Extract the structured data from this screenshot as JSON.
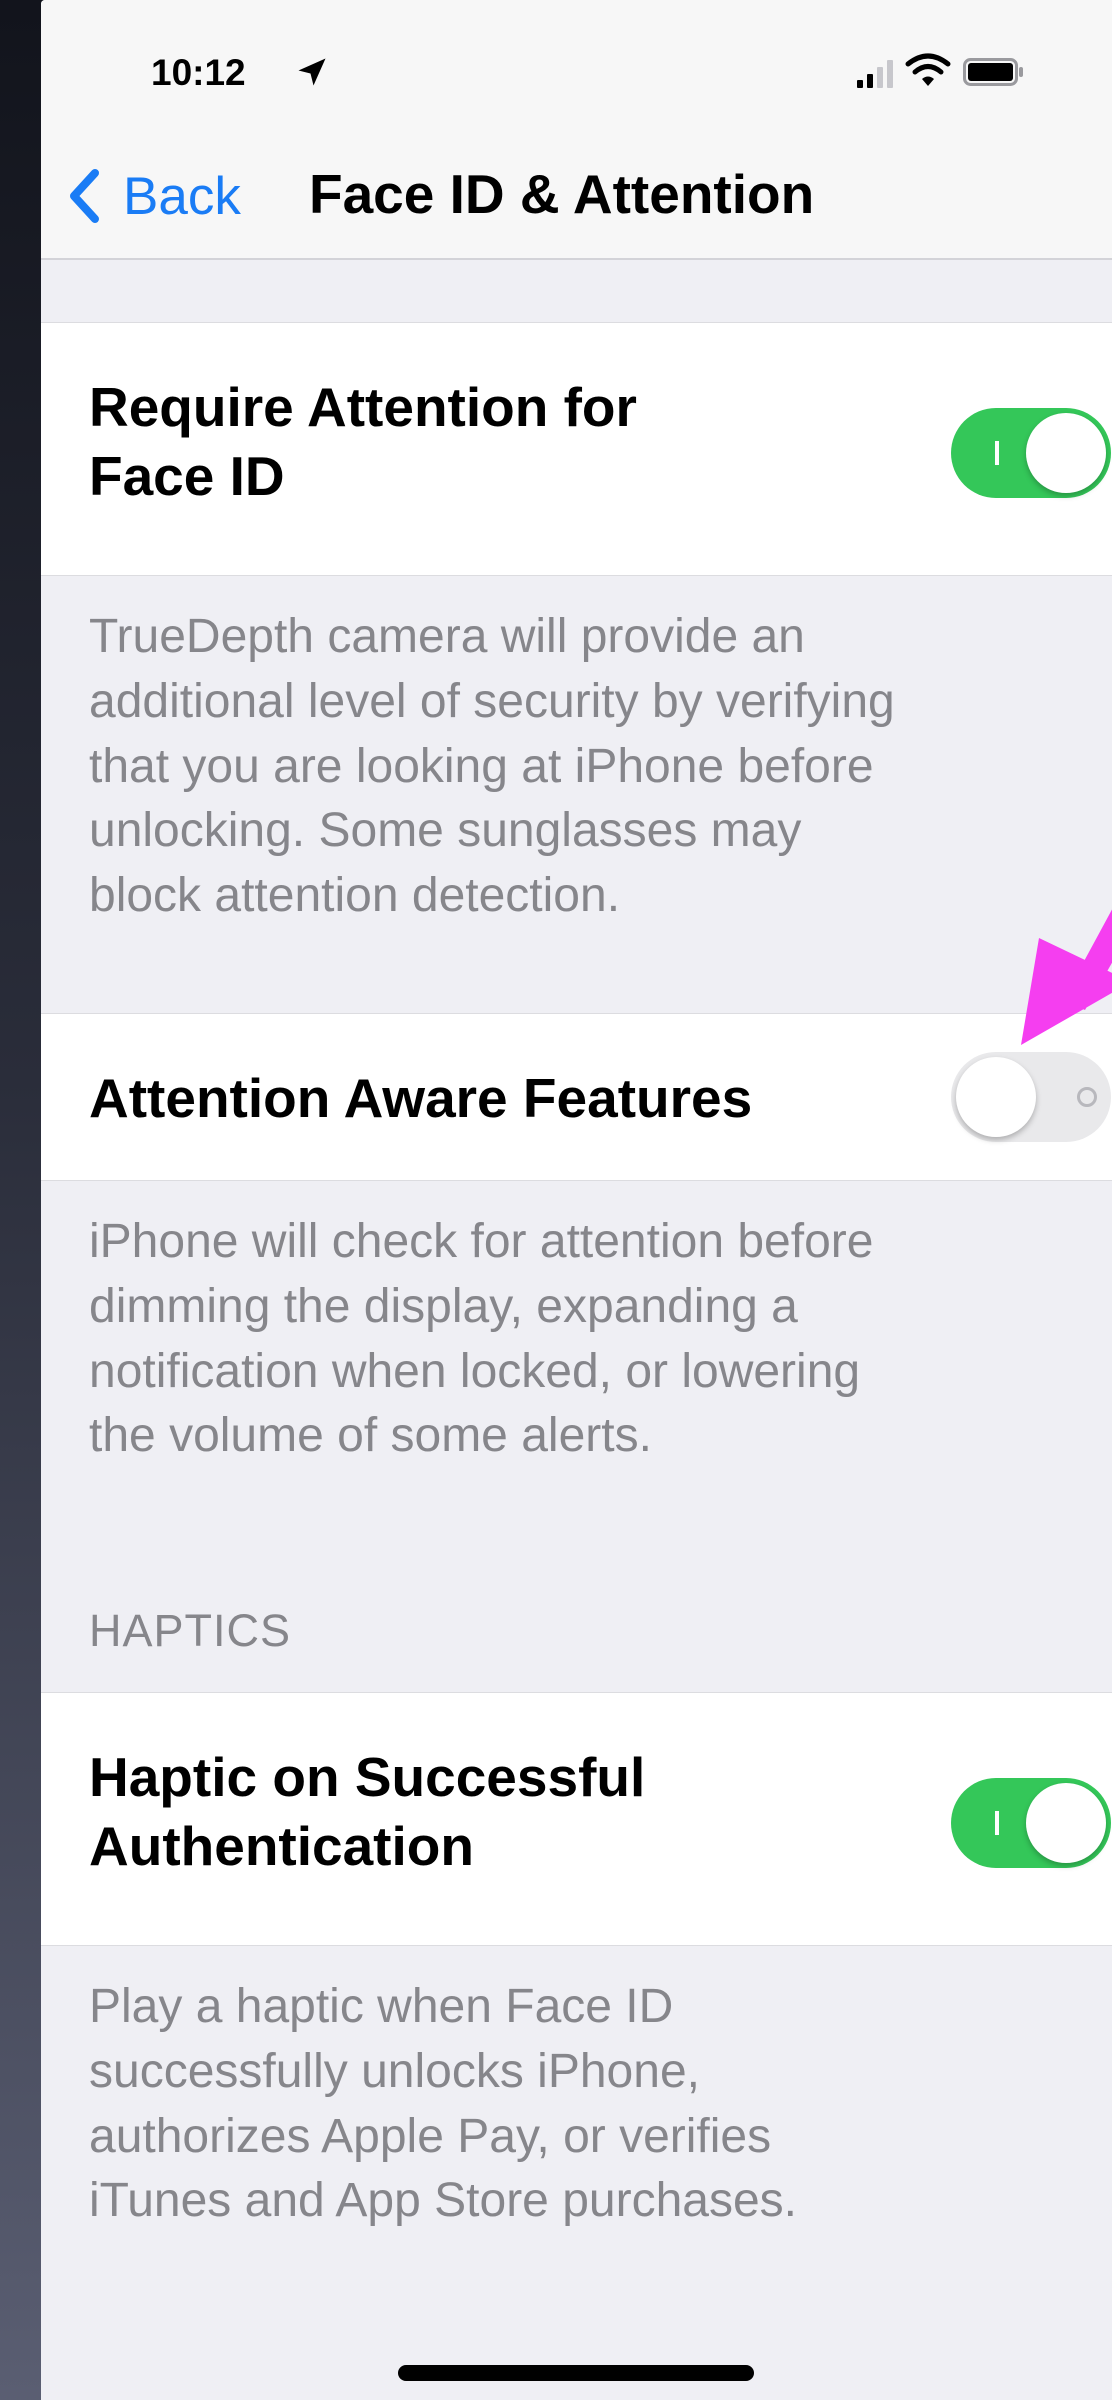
{
  "status_bar": {
    "time": "10:12",
    "icons": [
      "location-arrow-icon",
      "signal-bars-icon",
      "wifi-icon",
      "battery-icon"
    ]
  },
  "nav": {
    "back_label": "Back",
    "title": "Face ID & Attention"
  },
  "settings": {
    "require_attention": {
      "label_line1": "Require Attention for",
      "label_line2": "Face ID",
      "enabled": true,
      "footer_line1": "TrueDepth camera will provide an",
      "footer_line2": "additional level of security by verifying",
      "footer_line3": "that you are looking at iPhone before",
      "footer_line4": "unlocking. Some sunglasses may",
      "footer_line5": "block attention detection."
    },
    "attention_aware": {
      "label": "Attention Aware Features",
      "enabled": false,
      "footer_line1": "iPhone will check for attention before",
      "footer_line2": "dimming the display, expanding a",
      "footer_line3": "notification when locked, or lowering",
      "footer_line4": "the volume of some alerts."
    },
    "haptics_header": "HAPTICS",
    "haptic_success": {
      "label_line1": "Haptic on Successful",
      "label_line2": "Authentication",
      "enabled": true,
      "footer_line1": "Play a haptic when Face ID",
      "footer_line2": "successfully unlocks iPhone,",
      "footer_line3": "authorizes Apple Pay, or verifies",
      "footer_line4": "iTunes and App Store purchases."
    }
  },
  "colors": {
    "accent": "#1a7cf5",
    "toggle_on": "#34c759",
    "toggle_off": "#e9e9eb",
    "annotation_arrow": "#f53ef0",
    "grouped_background": "#efeff4"
  }
}
